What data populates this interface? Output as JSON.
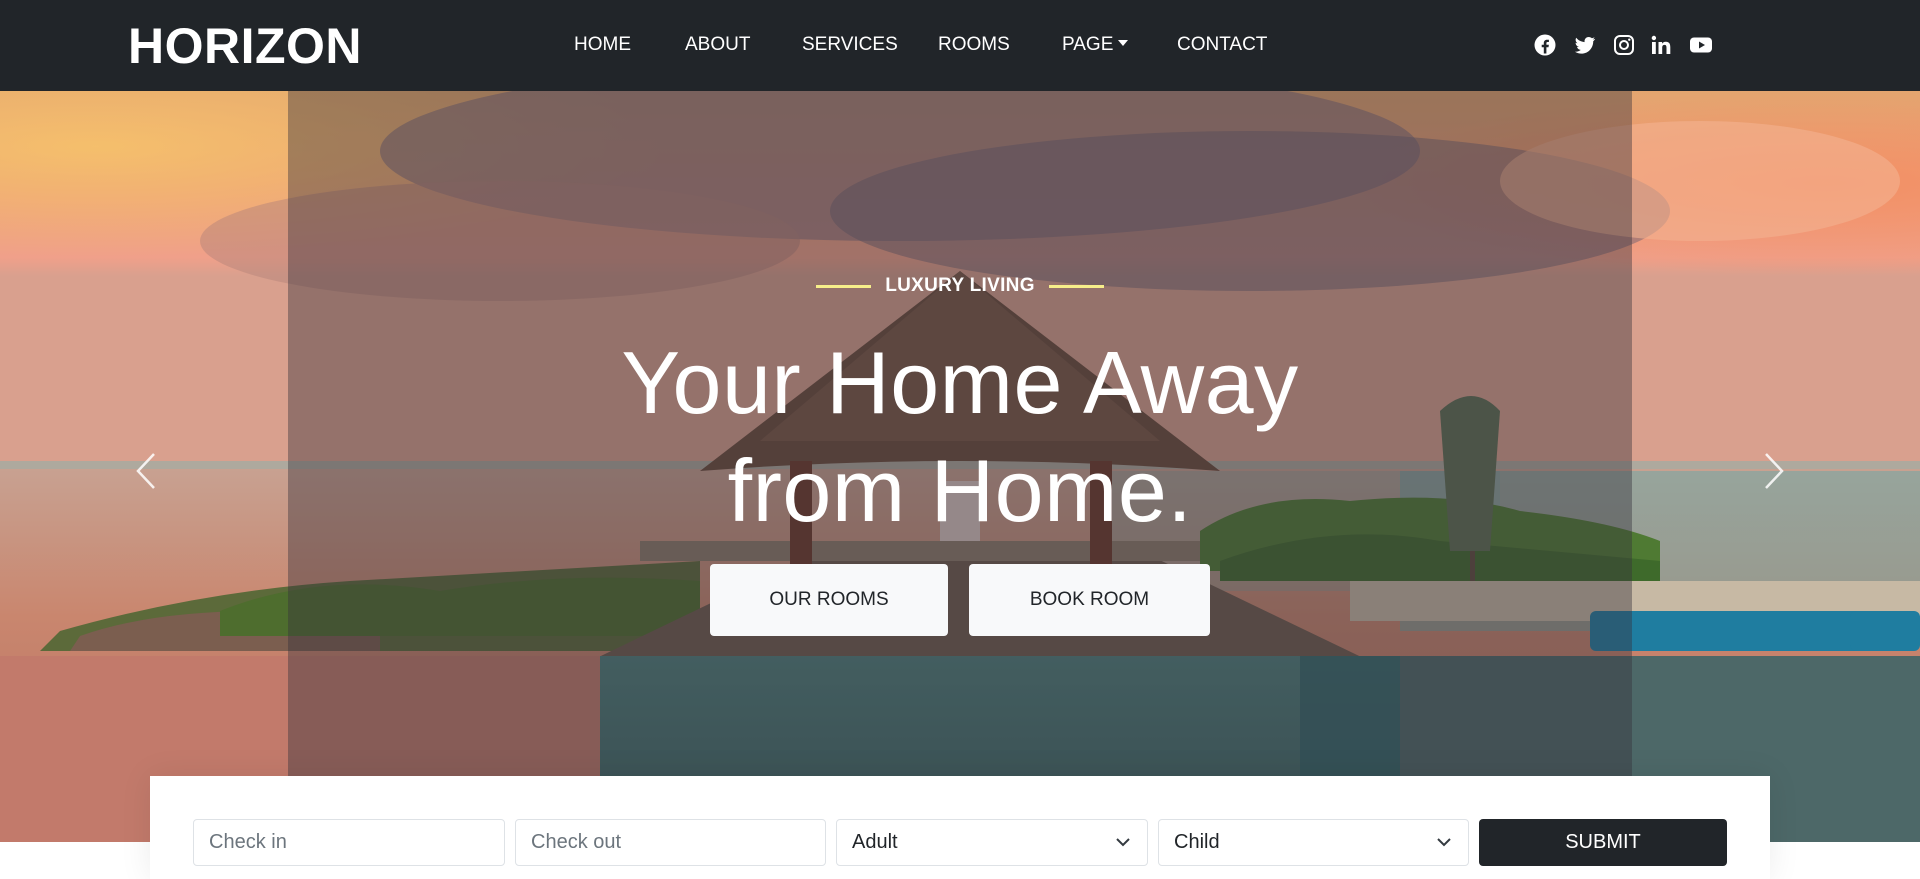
{
  "brand": "HORIZON",
  "nav": {
    "items": [
      {
        "label": "HOME"
      },
      {
        "label": "ABOUT"
      },
      {
        "label": "SERVICES"
      },
      {
        "label": "ROOMS"
      },
      {
        "label": "PAGE",
        "dropdown": true
      },
      {
        "label": "CONTACT"
      }
    ],
    "social": [
      "facebook-icon",
      "twitter-icon",
      "instagram-icon",
      "linkedin-icon",
      "youtube-icon"
    ]
  },
  "hero": {
    "tagline": "LUXURY LIVING",
    "headline_line1": "Your Home Away",
    "headline_line2": "from Home.",
    "buttons": {
      "rooms": "OUR ROOMS",
      "book": "BOOK ROOM"
    },
    "accent_color": "#f6ee8a"
  },
  "booking": {
    "checkin_placeholder": "Check in",
    "checkout_placeholder": "Check out",
    "adult_selected": "Adult",
    "child_selected": "Child",
    "submit": "SUBMIT"
  },
  "colors": {
    "navbar": "#212529",
    "button_light": "#f8f9fa",
    "button_dark": "#212529"
  }
}
